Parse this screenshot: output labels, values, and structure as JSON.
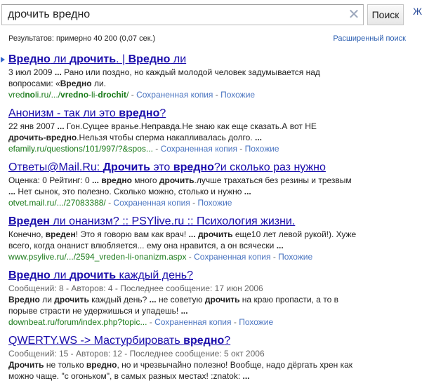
{
  "search": {
    "query": "дрочить вредно",
    "button_label": "Поиск",
    "clear_glyph": "✕"
  },
  "corner_glyph": "Ж",
  "stats": "Результатов: примерно 40 200 (0,07 сек.)",
  "advanced_search": "Расширенный поиск",
  "cache_label": "Сохраненная копия",
  "similar_label": "Похожие",
  "results": [
    {
      "title_parts": [
        {
          "t": "Вредно",
          "b": true
        },
        {
          "t": " ли ",
          "b": false
        },
        {
          "t": "дрочить",
          "b": true
        },
        {
          "t": ". | ",
          "b": false
        },
        {
          "t": "Вредно",
          "b": true
        },
        {
          "t": " ли",
          "b": false
        }
      ],
      "meta": "",
      "snippet_lines": [
        [
          {
            "t": "3 июл 2009 ",
            "b": false
          },
          {
            "t": "...",
            "b": true
          },
          {
            "t": " Рано или поздно, но каждый молодой человек задумывается над",
            "b": false
          }
        ],
        [
          {
            "t": "вопросами: «",
            "b": false
          },
          {
            "t": "Вредно",
            "b": true
          },
          {
            "t": " ли.",
            "b": false
          }
        ]
      ],
      "cite_parts": [
        {
          "t": "vred",
          "b": false
        },
        {
          "t": "no",
          "b": true
        },
        {
          "t": "li.ru/.../",
          "b": false
        },
        {
          "t": "vredno",
          "b": true
        },
        {
          "t": "-li-",
          "b": false
        },
        {
          "t": "drochit",
          "b": true
        },
        {
          "t": "/",
          "b": false
        }
      ],
      "has_arrow": true
    },
    {
      "title_parts": [
        {
          "t": "Анонизм - так ли это ",
          "b": false
        },
        {
          "t": "вредно",
          "b": true
        },
        {
          "t": "?",
          "b": false
        }
      ],
      "meta": "",
      "snippet_lines": [
        [
          {
            "t": "22 янв 2007 ",
            "b": false
          },
          {
            "t": "...",
            "b": true
          },
          {
            "t": " Гон.Сущее вранье.Неправда.Не знаю как еще сказать.А вот НЕ",
            "b": false
          }
        ],
        [
          {
            "t": "дрочить-вредно",
            "b": true
          },
          {
            "t": ".Нельзя чтобы сперма накапливалась долго. ",
            "b": false
          },
          {
            "t": "...",
            "b": true
          }
        ]
      ],
      "cite_parts": [
        {
          "t": "efamily.ru/questions/101/997/?&spos...",
          "b": false
        }
      ],
      "has_arrow": false
    },
    {
      "title_parts": [
        {
          "t": "Ответы@Mail.Ru: ",
          "b": false
        },
        {
          "t": "Дрочить",
          "b": true
        },
        {
          "t": " это ",
          "b": false
        },
        {
          "t": "вредно",
          "b": true
        },
        {
          "t": "?и сколько раз нужно",
          "b": false
        }
      ],
      "meta": "",
      "snippet_lines": [
        [
          {
            "t": "Оценка: 0 Рейтинг: 0 ",
            "b": false
          },
          {
            "t": "...",
            "b": true
          },
          {
            "t": " ",
            "b": false
          },
          {
            "t": "вредно",
            "b": true
          },
          {
            "t": " много ",
            "b": false
          },
          {
            "t": "дрочить",
            "b": true
          },
          {
            "t": ".лучше трахаться без резины и трезвым",
            "b": false
          }
        ],
        [
          {
            "t": "...",
            "b": true
          },
          {
            "t": " Нет сынок, это полезно. Сколько можно, столько и нужно ",
            "b": false
          },
          {
            "t": "...",
            "b": true
          }
        ]
      ],
      "cite_parts": [
        {
          "t": "otvet.mail.ru/.../27083388/",
          "b": false
        }
      ],
      "has_arrow": false
    },
    {
      "title_parts": [
        {
          "t": "Вреден",
          "b": true
        },
        {
          "t": " ли онанизм? :: PSYlive.ru :: Психология жизни.",
          "b": false
        }
      ],
      "meta": "",
      "snippet_lines": [
        [
          {
            "t": "Конечно, ",
            "b": false
          },
          {
            "t": "вреден",
            "b": true
          },
          {
            "t": "! Это я говорю вам как врач! ",
            "b": false
          },
          {
            "t": "...",
            "b": true
          },
          {
            "t": " ",
            "b": false
          },
          {
            "t": "дрочить",
            "b": true
          },
          {
            "t": " еще10 лет левой рукой!). Хуже",
            "b": false
          }
        ],
        [
          {
            "t": "всего, когда онанист влюбляется... ему она нравится, а он всячески ",
            "b": false
          },
          {
            "t": "...",
            "b": true
          }
        ]
      ],
      "cite_parts": [
        {
          "t": "www.psylive.ru/.../2594_vreden-li-onanizm.aspx",
          "b": false
        }
      ],
      "has_arrow": false
    },
    {
      "title_parts": [
        {
          "t": "Вредно",
          "b": true
        },
        {
          "t": " ли ",
          "b": false
        },
        {
          "t": "дрочить",
          "b": true
        },
        {
          "t": " каждый день?",
          "b": false
        }
      ],
      "meta": "Сообщений: 8 - Авторов: 4 - Последнее сообщение: 17 июн 2006",
      "snippet_lines": [
        [
          {
            "t": "Вредно",
            "b": true
          },
          {
            "t": " ли ",
            "b": false
          },
          {
            "t": "дрочить",
            "b": true
          },
          {
            "t": " каждый день? ",
            "b": false
          },
          {
            "t": "...",
            "b": true
          },
          {
            "t": " не советую ",
            "b": false
          },
          {
            "t": "дрочить",
            "b": true
          },
          {
            "t": " на краю пропасти, а то в",
            "b": false
          }
        ],
        [
          {
            "t": "порыве страсти не удержишься и упадешь! ",
            "b": false
          },
          {
            "t": "...",
            "b": true
          }
        ]
      ],
      "cite_parts": [
        {
          "t": "downbeat.ru/forum/index.php?topic...",
          "b": false
        }
      ],
      "has_arrow": false
    },
    {
      "title_parts": [
        {
          "t": "QWERTY.WS -> Мастурбировать ",
          "b": false
        },
        {
          "t": "вредно",
          "b": true
        },
        {
          "t": "?",
          "b": false
        }
      ],
      "meta": "Сообщений: 15 - Авторов: 12 - Последнее сообщение: 5 окт 2006",
      "snippet_lines": [
        [
          {
            "t": "Дрочить",
            "b": true
          },
          {
            "t": " не только ",
            "b": false
          },
          {
            "t": "вредно",
            "b": true
          },
          {
            "t": ", но и чрезвычайно полезно! Вообще, надо дёргать хрен как",
            "b": false
          }
        ],
        [
          {
            "t": "можно чаще. \"с огоньком\", в самых разных местах! :znatok: ",
            "b": false
          },
          {
            "t": "...",
            "b": true
          }
        ]
      ],
      "cite_parts": [],
      "has_arrow": false
    }
  ],
  "colors": {
    "link": "#1a0dab",
    "url": "#1a7a1a",
    "sub_link": "#4a74c0",
    "arrow": "#3366cc"
  }
}
